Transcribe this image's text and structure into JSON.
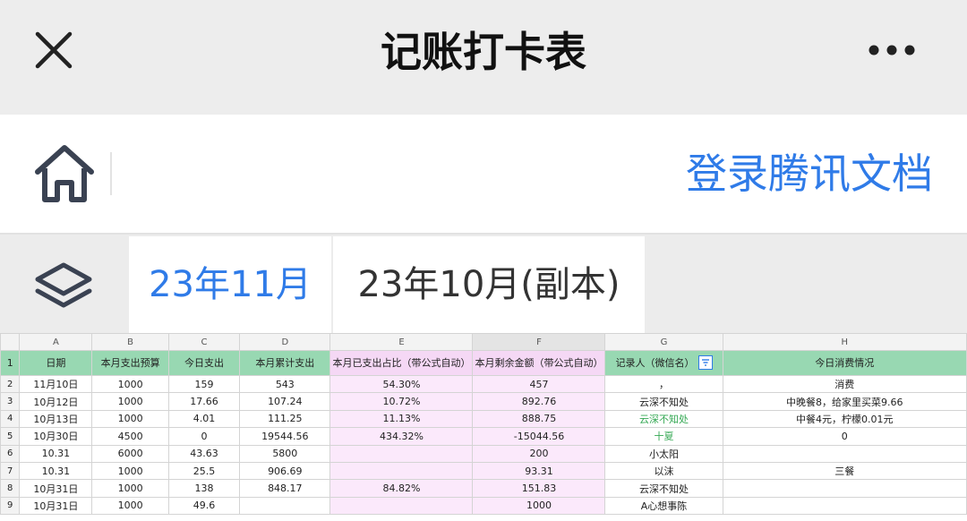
{
  "window": {
    "title": "记账打卡表"
  },
  "toolbar": {
    "login_label": "登录腾讯文档"
  },
  "tabs": [
    {
      "label": "23年11月",
      "active": true
    },
    {
      "label": "23年10月(副本)",
      "active": false
    }
  ],
  "colors": {
    "accent": "#2f7be8",
    "header_green": "#98d8b2",
    "header_purple": "#f5d8f5",
    "cell_pink": "#fbe9fb",
    "recorder_green": "#34a853"
  },
  "sheet": {
    "column_letters": [
      "A",
      "B",
      "C",
      "D",
      "E",
      "F",
      "G",
      "H"
    ],
    "header_row_number": "1",
    "headers": [
      "日期",
      "本月支出预算",
      "今日支出",
      "本月累计支出",
      "本月已支出占比（带公式自动）",
      "本月剩余金额（带公式自动）",
      "记录人（微信名）",
      "今日消费情况"
    ],
    "rows": [
      {
        "num": "2",
        "cells": [
          "11月10日",
          "1000",
          "159",
          "543",
          "54.30%",
          "457",
          "，",
          "消费"
        ]
      },
      {
        "num": "3",
        "cells": [
          "10月12日",
          "1000",
          "17.66",
          "107.24",
          "10.72%",
          "892.76",
          "云深不知处",
          "中晚餐8，给家里买菜9.66"
        ]
      },
      {
        "num": "4",
        "cells": [
          "10月13日",
          "1000",
          "4.01",
          "111.25",
          "11.13%",
          "888.75",
          "云深不知处",
          "中餐4元，柠檬0.01元"
        ]
      },
      {
        "num": "5",
        "cells": [
          "10月30日",
          "4500",
          "0",
          "19544.56",
          "434.32%",
          "-15044.56",
          "十夏",
          "0"
        ]
      },
      {
        "num": "6",
        "cells": [
          "10.31",
          "6000",
          "43.63",
          "5800",
          "",
          "200",
          "小太阳",
          ""
        ]
      },
      {
        "num": "7",
        "cells": [
          "10.31",
          "1000",
          "25.5",
          "906.69",
          "",
          "93.31",
          "以沫",
          "三餐"
        ]
      },
      {
        "num": "8",
        "cells": [
          "10月31日",
          "1000",
          "138",
          "848.17",
          "84.82%",
          "151.83",
          "云深不知处",
          ""
        ]
      },
      {
        "num": "9",
        "cells": [
          "10月31日",
          "1000",
          "49.6",
          "",
          "",
          "1000",
          "A心想事陈",
          ""
        ]
      }
    ]
  }
}
